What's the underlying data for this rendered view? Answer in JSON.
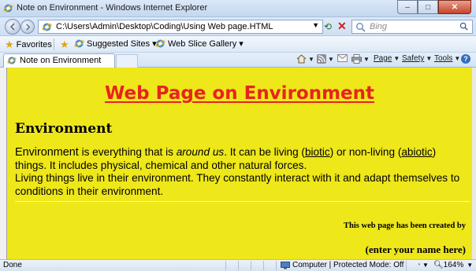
{
  "window": {
    "title": "Note on Environment - Windows Internet Explorer",
    "minimize_glyph": "–",
    "maximize_glyph": "□",
    "close_glyph": "✕"
  },
  "address_bar": {
    "url": "C:\\Users\\Admin\\Desktop\\Coding\\Using Web page.HTML",
    "search_placeholder": "Bing"
  },
  "favorites_bar": {
    "favorites_label": "Favorites",
    "items": [
      {
        "label": "Suggested Sites ▾"
      },
      {
        "label": "Web Slice Gallery ▾"
      }
    ]
  },
  "tabs": [
    {
      "label": "Note on Environment"
    }
  ],
  "command_bar": {
    "page_label": "Page",
    "safety_label": "Safety",
    "tools_label": "Tools",
    "help_glyph": "?"
  },
  "page": {
    "heading": "Web Page on Environment",
    "section_heading": "Environment",
    "paragraph": {
      "term": "Environment",
      "text1": " is everything that is ",
      "emphasis": "around us",
      "text2": ". It can be living (",
      "link1": "biotic",
      "text3": ") or non-living (",
      "link2": "abiotic",
      "text4": ") things. It includes physical, chemical and other natural forces.",
      "line2": "Living things live in their environment. They constantly interact with it and adapt themselves to conditions in their environment."
    },
    "credit": "This web page has been created by",
    "name_placeholder": "(enter your name here)"
  },
  "status_bar": {
    "status": "Done",
    "zone": "Computer | Protected Mode: Off",
    "zoom": "164%"
  },
  "colors": {
    "page_background": "#eee71a",
    "heading_color": "#e8231f"
  }
}
